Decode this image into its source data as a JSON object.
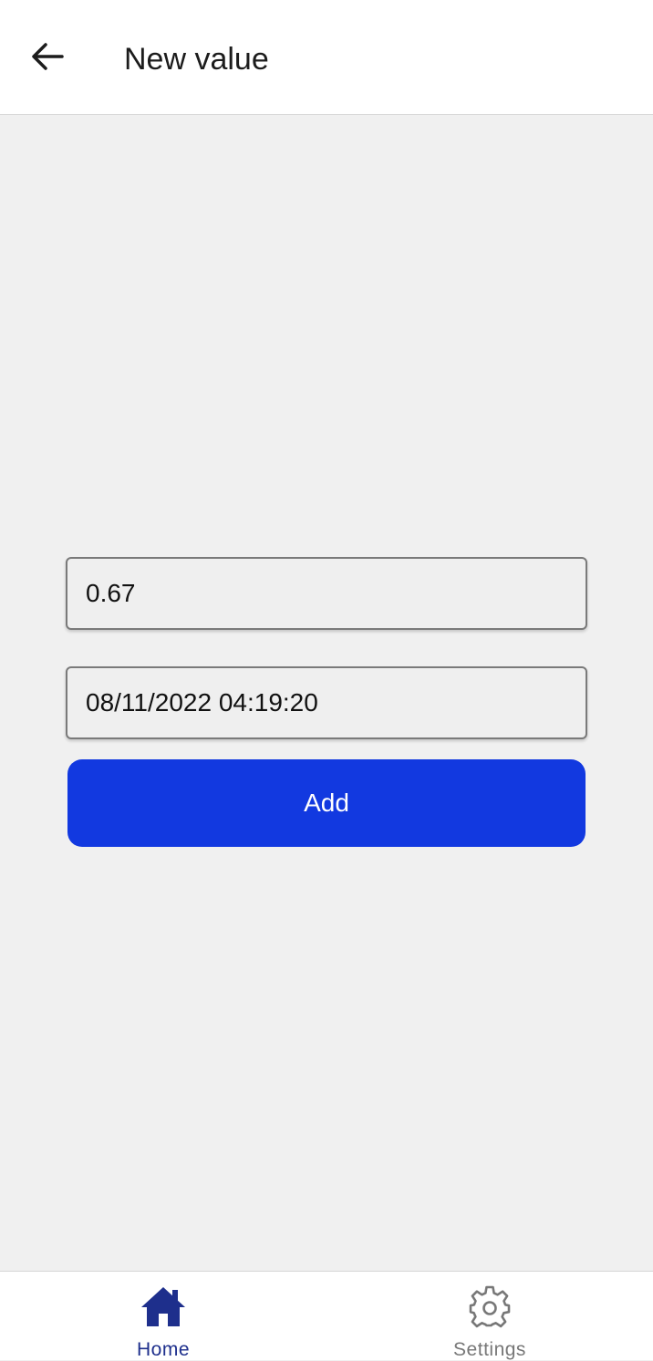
{
  "header": {
    "back_icon": "arrow-left-icon",
    "title": "New value"
  },
  "form": {
    "value_input": "0.67",
    "date_input": "08/11/2022 04:19:20",
    "add_label": "Add"
  },
  "tabs": [
    {
      "label": "Home",
      "icon": "home-icon",
      "active": true
    },
    {
      "label": "Settings",
      "icon": "gear-icon",
      "active": false
    }
  ],
  "colors": {
    "accent": "#1239e0",
    "active_tab": "#1e2f8c",
    "inactive_tab": "#777777",
    "background": "#f0f0f0"
  }
}
